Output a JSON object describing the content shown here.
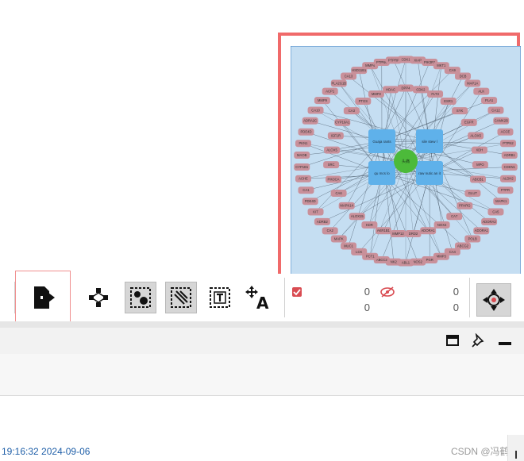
{
  "preview": {
    "background": "#c5def2",
    "node_color": "#c9909a",
    "center_color": "#4cba3a",
    "hub_color": "#5fb1ea",
    "center_label": "头痛",
    "hub_labels": [
      "Guaja rants",
      "sile stew l",
      "qu mcs lo",
      "raw nutic an it"
    ],
    "outer_ring": [
      "CDK1",
      "XIAP",
      "PIK3R1",
      "MKT1",
      "CA9",
      "DCB",
      "MAP1A",
      "ALK",
      "PLA1",
      "CA12",
      "CAMK2B",
      "ACCE",
      "PTPN2",
      "ADRB1",
      "CDKN1",
      "ALDH2",
      "PTPR",
      "MAPK1",
      "CA5",
      "ADORA2",
      "ADORA1",
      "POLB",
      "ABCG2",
      "CA4",
      "MMP3",
      "PGR",
      "NOS2",
      "ABL1",
      "NK2",
      "ABCC2",
      "PCT1",
      "LCK",
      "MUC1",
      "MAPK",
      "CA2",
      "ADRB2",
      "KIT",
      "PDE4D",
      "CA1",
      "ACHE",
      "CYP1B1",
      "MAOB",
      "PKN1",
      "PDE4D",
      "ADRA2C",
      "CA10",
      "MMP9",
      "ACP1",
      "PLA2G1B",
      "CA13",
      "HSD11B1",
      "MMP4",
      "PTPN6",
      "PTPRF"
    ],
    "inner_ring": [
      "DPP4",
      "CDK2",
      "FLT3",
      "ESR1",
      "SYK",
      "EGFR",
      "ALOX5",
      "XDH",
      "MPO",
      "ABCB1",
      "GLUT",
      "PPARG",
      "CA7",
      "NOX4",
      "ADORA1",
      "DRD2",
      "MMP12",
      "AKR1B1",
      "KDR",
      "ALOX15",
      "MAPK14",
      "CA6",
      "PIK3CA",
      "SRC",
      "ALOX5",
      "IGF1R",
      "CYP19A1",
      "CA3",
      "PTGS",
      "MMP2",
      "HDAC"
    ]
  },
  "toolbar": {
    "icons": [
      "export-icon",
      "layout-icon",
      "select-nodes-icon",
      "select-edges-icon",
      "text-icon",
      "move-text-icon"
    ],
    "counter_top_left": "0",
    "counter_bottom_left": "0",
    "counter_top_right": "0",
    "counter_bottom_right": "0",
    "center_icon": "crosshair-icon"
  },
  "window_controls": [
    "maximize-icon",
    "pin-icon",
    "minimize-icon"
  ],
  "status": {
    "timestamp": "19:16:32 2024-09-06"
  },
  "watermark": "CSDN @冯鹤和"
}
